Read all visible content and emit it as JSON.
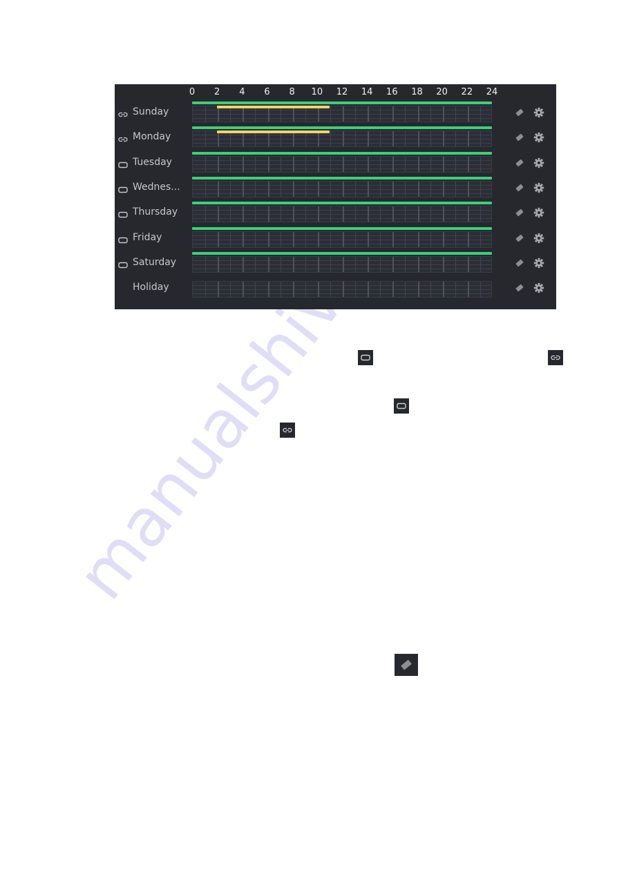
{
  "watermark": "manualshive.com",
  "schedule": {
    "hour_labels": [
      "0",
      "2",
      "4",
      "6",
      "8",
      "10",
      "12",
      "14",
      "16",
      "18",
      "20",
      "22",
      "24"
    ],
    "hours_range": [
      0,
      24
    ],
    "colors": {
      "primary": "#3bcf7a",
      "secondary": "#f2d36a",
      "panel_bg": "#26282e"
    },
    "rows": [
      {
        "label": "Sunday",
        "link_icon": "linked-icon",
        "primary": [
          [
            0,
            24
          ]
        ],
        "secondary": [
          [
            2,
            11
          ]
        ]
      },
      {
        "label": "Monday",
        "link_icon": "linked-icon",
        "primary": [
          [
            0,
            24
          ]
        ],
        "secondary": [
          [
            2,
            11
          ]
        ]
      },
      {
        "label": "Tuesday",
        "link_icon": "unlinked-icon",
        "primary": [
          [
            0,
            24
          ]
        ],
        "secondary": []
      },
      {
        "label": "Wednes...",
        "link_icon": "unlinked-icon",
        "primary": [
          [
            0,
            24
          ]
        ],
        "secondary": []
      },
      {
        "label": "Thursday",
        "link_icon": "unlinked-icon",
        "primary": [
          [
            0,
            24
          ]
        ],
        "secondary": []
      },
      {
        "label": "Friday",
        "link_icon": "unlinked-icon",
        "primary": [
          [
            0,
            24
          ]
        ],
        "secondary": []
      },
      {
        "label": "Saturday",
        "link_icon": "unlinked-icon",
        "primary": [
          [
            0,
            24
          ]
        ],
        "secondary": []
      },
      {
        "label": "Holiday",
        "link_icon": null,
        "primary": [],
        "secondary": []
      }
    ],
    "row_actions": [
      "eraser-icon",
      "gear-icon"
    ]
  },
  "inline_icons": [
    {
      "name": "unlinked-icon"
    },
    {
      "name": "linked-icon"
    },
    {
      "name": "unlinked-icon"
    },
    {
      "name": "linked-icon"
    }
  ],
  "eraser_icon": "eraser-icon"
}
